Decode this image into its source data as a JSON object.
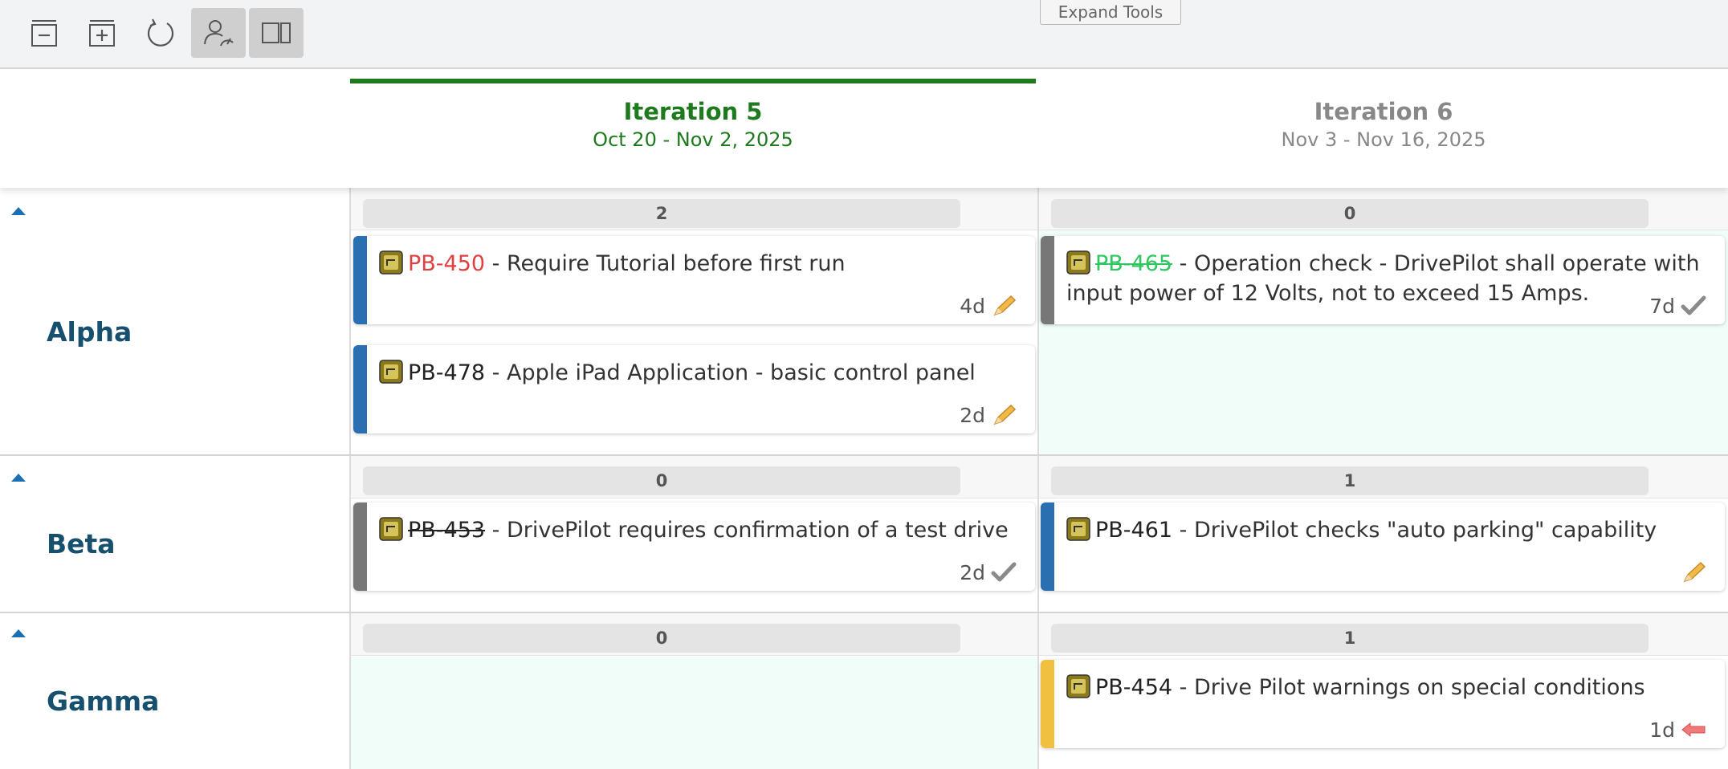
{
  "toolbar": {
    "buttons": [
      {
        "name": "collapse-all-icon"
      },
      {
        "name": "expand-all-icon"
      },
      {
        "name": "refresh-icon"
      },
      {
        "name": "user-performance-icon",
        "active": true
      },
      {
        "name": "split-view-icon",
        "active": true
      }
    ],
    "expand_tools": "Expand Tools"
  },
  "iterations": [
    {
      "name": "Iteration 5",
      "dates": "Oct 20 - Nov 2, 2025",
      "state": "current",
      "color": "#1d7a1d"
    },
    {
      "name": "Iteration 6",
      "dates": "Nov 3 - Nov 16, 2025",
      "state": "future",
      "color": "#888888"
    }
  ],
  "lanes": [
    {
      "name": "Alpha",
      "counts": [
        "2",
        "0"
      ]
    },
    {
      "name": "Beta",
      "counts": [
        "0",
        "1"
      ]
    },
    {
      "name": "Gamma",
      "counts": [
        "0",
        "1"
      ]
    }
  ],
  "cards": [
    {
      "id": "PB-450",
      "title": " - Require Tutorial before first run",
      "estimate": "4d",
      "status_icon": "pencil-icon",
      "stripe": "#2a6fb0",
      "id_style": "red"
    },
    {
      "id": "PB-478",
      "title": " - Apple iPad Application - basic control panel",
      "estimate": "2d",
      "status_icon": "pencil-icon",
      "stripe": "#2a6fb0",
      "id_style": "normal"
    },
    {
      "id": "PB-465",
      "title": " - Operation check - DrivePilot shall operate with input power of 12 Volts, not to exceed 15 Amps.",
      "estimate": "7d",
      "status_icon": "checkmark-icon",
      "stripe": "#777777",
      "id_style": "greenstrike"
    },
    {
      "id": "PB-453",
      "title": " - DrivePilot requires confirmation of a test drive",
      "estimate": "2d",
      "status_icon": "checkmark-icon",
      "stripe": "#777777",
      "id_style": "strike"
    },
    {
      "id": "PB-461",
      "title": " - DrivePilot checks \"auto parking\" capability",
      "estimate": "",
      "status_icon": "pencil-icon",
      "stripe": "#2a6fb0",
      "id_style": "normal"
    },
    {
      "id": "PB-454",
      "title": " - Drive Pilot warnings on special conditions",
      "estimate": "1d",
      "status_icon": "back-arrow-icon",
      "stripe": "#f0c040",
      "id_style": "normal"
    }
  ]
}
